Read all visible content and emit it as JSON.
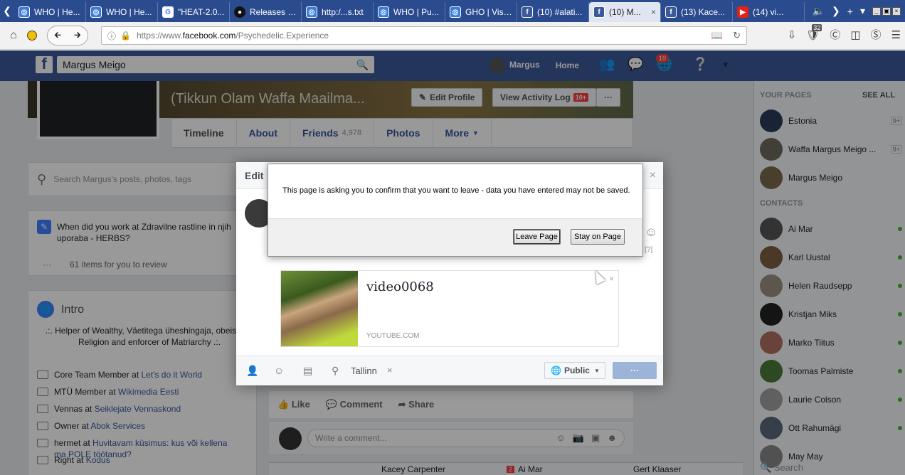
{
  "browser": {
    "tabs": [
      {
        "label": "WHO | He...",
        "icon": "who"
      },
      {
        "label": "WHO | He...",
        "icon": "who"
      },
      {
        "label": "\"HEAT-2.0...",
        "icon": "google"
      },
      {
        "label": "Releases ·...",
        "icon": "github"
      },
      {
        "label": "http:/...s.txt",
        "icon": "who"
      },
      {
        "label": "WHO | Pu...",
        "icon": "who"
      },
      {
        "label": "GHO | Visu...",
        "icon": "who"
      },
      {
        "label": "(10) #alati...",
        "icon": "facebook"
      },
      {
        "label": "(10) M...",
        "icon": "facebook",
        "active": true
      },
      {
        "label": "(13) Kace...",
        "icon": "facebook"
      },
      {
        "label": "(14) vi...",
        "icon": "youtube"
      }
    ],
    "url_prefix": "https://www.",
    "url_host": "facebook.com",
    "url_path": "/Psychedelic.Experience",
    "badge_count": "32"
  },
  "facebook": {
    "search_value": "Margus Meigo",
    "nav_user": "Margus",
    "nav_home": "Home",
    "notification_count": "10",
    "profile_name": "Margus Meigo",
    "profile_alt_name": "(Tikkun Olam Waffa Maailma...",
    "edit_profile": "Edit Profile",
    "activity_log": "View Activity Log",
    "activity_badge": "10+",
    "more_dots": "···",
    "tabs": {
      "timeline": "Timeline",
      "about": "About",
      "friends": "Friends",
      "friends_count": "4,978",
      "photos": "Photos",
      "more": "More"
    },
    "left": {
      "search_placeholder": "Search Margus's posts, photos, tags",
      "question": "When did you work at Zdravilne rastline in njih uporaba - HERBS?",
      "review": "61 items for you to review",
      "intro_title": "Intro",
      "bio": ".:. Helper of Wealthy, Väetitega üheshingaja, obeisor of Religion and enforcer of Matriarchy .:.",
      "work": [
        {
          "role": "Core Team Member at ",
          "place": "Let's do it World"
        },
        {
          "role": "MTÜ Member at ",
          "place": "Wikimedia Eesti"
        },
        {
          "role": "Vennas at ",
          "place": "Seiklejate Vennaskond"
        },
        {
          "role": "Owner at ",
          "place": "Abok Services"
        },
        {
          "role": "hermet at ",
          "place": "Huvitavam küsimus: kus või kellena ma POLE töötanud?"
        },
        {
          "role": "Right at ",
          "place": "Kodus"
        }
      ]
    },
    "post": {
      "like": "Like",
      "comment": "Comment",
      "share": "Share",
      "comment_placeholder": "Write a comment..."
    },
    "sidebar": {
      "your_pages": "YOUR PAGES",
      "see_all": "SEE ALL",
      "pages": [
        {
          "name": "Estonia",
          "badge": "9+"
        },
        {
          "name": "Waffa Margus Meigo ...",
          "badge": "9+"
        },
        {
          "name": "Margus Meigo",
          "badge": ""
        }
      ],
      "contacts_title": "CONTACTS",
      "contacts": [
        "Ai Mar",
        "Karl Uustal",
        "Helen Raudsepp",
        "Kristjan Miks",
        "Marko Tiitus",
        "Toomas Palmiste",
        "Laurie Colson",
        "Ott Rahumägi",
        "May May"
      ],
      "search": "Search"
    },
    "chatbar": {
      "kacey": "Kacey Carpenter",
      "ai_count": "2",
      "ai": "Ai Mar",
      "gert": "Gert Klaaser"
    }
  },
  "edit_modal": {
    "title": "Edit",
    "link_title": "video0068",
    "link_source": "YOUTUBE.COM",
    "help": "[?]",
    "location": "Tallinn",
    "privacy": "Public",
    "post_label": "···"
  },
  "confirm_dialog": {
    "message": "This page is asking you to confirm that you want to leave - data you have entered may not be saved.",
    "leave": "Leave Page",
    "stay": "Stay on Page"
  }
}
